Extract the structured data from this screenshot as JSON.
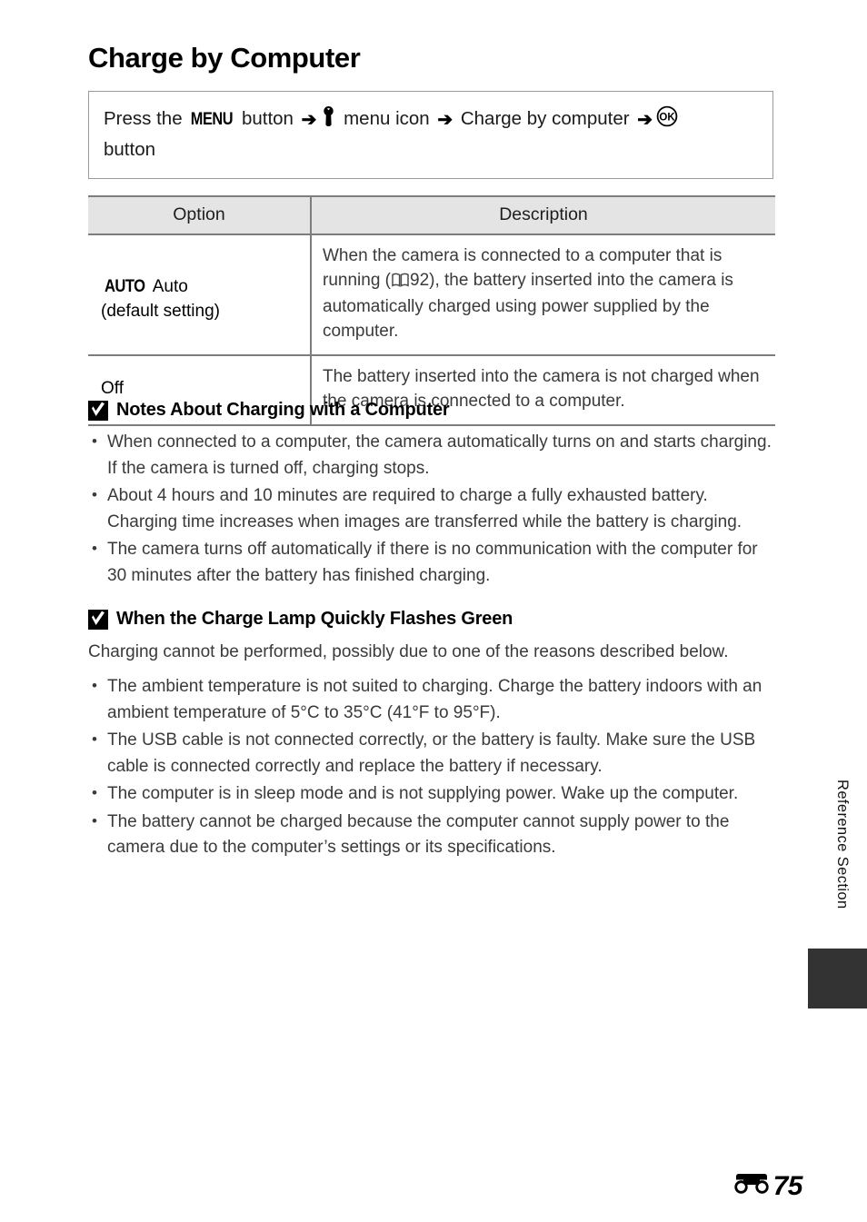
{
  "page": {
    "title": "Charge by Computer",
    "side_label": "Reference Section",
    "page_number": "75",
    "footer_icon": "reference-section-icon"
  },
  "instruction": {
    "line1_pre": "Press the ",
    "menu_label": "MENU",
    "line1_mid1": " button ",
    "arrow": "➔",
    "wrench_icon": "setup-wrench-icon",
    "line1_mid2": " menu icon ",
    "line1_item": " Charge by computer ",
    "ok_icon": "ok-button-icon",
    "line2": "button"
  },
  "table": {
    "headers": [
      "Option",
      "Description"
    ],
    "rows": [
      {
        "option_glyph": "AUTO",
        "option_label": " Auto",
        "option_sub": "(default setting)",
        "description_pre": "When the camera is connected to a computer that is running (",
        "book_icon": "manual-book-icon",
        "description_ref": "92",
        "description_post": "), the battery inserted into the camera is automatically charged using power supplied by the computer."
      },
      {
        "option_glyph": "",
        "option_label": "Off",
        "option_sub": "",
        "description_pre": "The battery inserted into the camera is not charged when the camera is connected to a computer.",
        "book_icon": "",
        "description_ref": "",
        "description_post": ""
      }
    ]
  },
  "notes_charging": {
    "icon": "caution-check-icon",
    "heading": "Notes About Charging with a Computer",
    "items": [
      "When connected to a computer, the camera automatically turns on and starts charging. If the camera is turned off, charging stops.",
      "About 4 hours and 10 minutes are required to charge a fully exhausted battery. Charging time increases when images are transferred while the battery is charging.",
      "The camera turns off automatically if there is no communication with the computer for 30 minutes after the battery has finished charging."
    ]
  },
  "notes_lamp": {
    "icon": "caution-check-icon",
    "heading": "When the Charge Lamp Quickly Flashes Green",
    "lead": "Charging cannot be performed, possibly due to one of the reasons described below.",
    "items": [
      "The ambient temperature is not suited to charging. Charge the battery indoors with an ambient temperature of 5°C to 35°C (41°F to 95°F).",
      "The USB cable is not connected correctly, or the battery is faulty. Make sure the USB cable is connected correctly and replace the battery if necessary.",
      "The computer is in sleep mode and is not supplying power. Wake up the computer.",
      "The battery cannot be charged because the computer cannot supply power to the camera due to the computer’s settings or its specifications."
    ]
  },
  "colors": {
    "text": "#3a3a3a",
    "heading": "#000000",
    "table_header_bg": "#e4e4e4",
    "table_border": "#7d7d7d",
    "box_border": "#9a9a9a",
    "side_tab": "#333333"
  }
}
